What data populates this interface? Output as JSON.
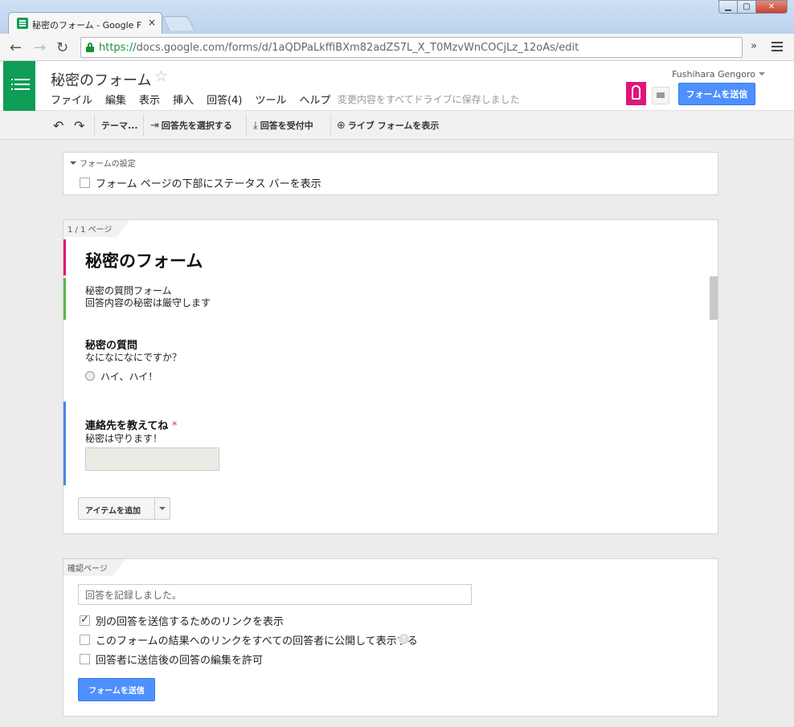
{
  "browser": {
    "tab_title": "秘密のフォーム - Google F",
    "tab_close": "×",
    "url_scheme": "https://",
    "url_rest": "docs.google.com/forms/d/1aQDPaLkffiBXm82adZS7L_X_T0MzvWnCOCjLz_12oAs/edit",
    "overflow": "»",
    "window_buttons": {
      "minimize": "▁",
      "maximize": "▢",
      "close": "✕"
    }
  },
  "header": {
    "doc_title": "秘密のフォーム",
    "star": "☆",
    "menus": [
      "ファイル",
      "編集",
      "表示",
      "挿入",
      "回答(4)",
      "ツール",
      "ヘルプ"
    ],
    "save_status": "変更内容をすべてドライブに保存しました",
    "user_name": "Fushihara Gengoro",
    "send_button": "フォームを送信"
  },
  "toolbar": {
    "undo": "↶",
    "redo": "↷",
    "theme": "テーマ...",
    "choose_destination": "回答先を選択する",
    "accepting": "回答を受付中",
    "view_live": "ライブ フォームを表示"
  },
  "settings": {
    "heading": "フォームの設定",
    "show_progress": {
      "label": "フォーム ページの下部にステータス バーを表示",
      "checked": false
    }
  },
  "form": {
    "page_label": "1 / 1 ページ",
    "title": "秘密のフォーム",
    "description_lines": [
      "秘密の質問フォーム",
      "回答内容の秘密は厳守します"
    ],
    "q1": {
      "title": "秘密の質問",
      "help": "なになになにですか？",
      "option": "ハイ、ハイ！"
    },
    "q2": {
      "title": "連絡先を教えてね",
      "required_mark": "*",
      "help": "秘密は守ります！"
    },
    "add_item": "アイテムを追加"
  },
  "confirmation": {
    "page_label": "確認ページ",
    "message": "回答を記録しました。",
    "options": [
      {
        "label": "別の回答を送信するためのリンクを表示",
        "checked": true
      },
      {
        "label": "このフォームの結果へのリンクをすべての回答者に公開して表示する",
        "checked": false
      },
      {
        "label": "回答者に送信後の回答の編集を許可",
        "checked": false
      }
    ],
    "help_icon": "?",
    "submit_button": "フォームを送信"
  },
  "colors": {
    "accent_blue": "#4d90fe",
    "forms_green": "#0f9d58",
    "title_bar_pink": "#e0147b",
    "description_bar_green": "#57bb47",
    "question_bar_blue": "#4a86e8"
  },
  "icons": [
    "document-favicon-icon",
    "back-icon",
    "forward-icon",
    "reload-icon",
    "lock-icon",
    "chrome-menu-icon",
    "forms-menu-icon",
    "star-icon",
    "avatar-icon",
    "comment-icon",
    "undo-icon",
    "redo-icon",
    "destination-icon",
    "download-icon",
    "globe-link-icon",
    "help-icon"
  ]
}
